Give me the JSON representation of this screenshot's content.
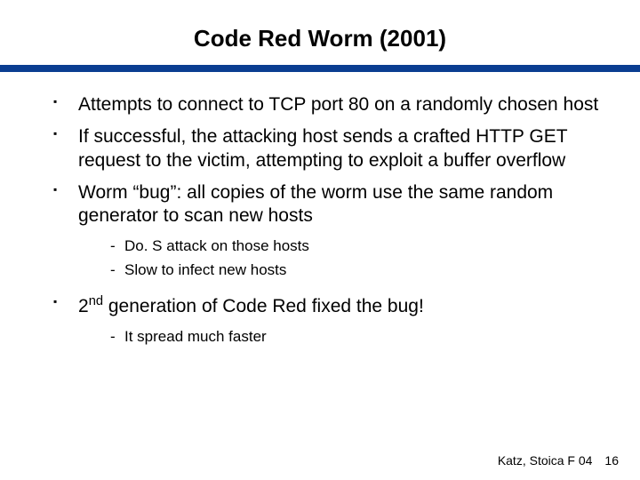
{
  "title": "Code Red Worm (2001)",
  "bullets": [
    {
      "text": "Attempts to connect to TCP port 80 on a randomly chosen host"
    },
    {
      "text": "If successful, the attacking host sends a crafted HTTP GET request to the victim, attempting to exploit a buffer overflow"
    },
    {
      "text": "Worm “bug”: all copies of the worm use the same random generator to scan new hosts",
      "sub": [
        "Do. S attack on those hosts",
        "Slow to infect new hosts"
      ]
    },
    {
      "ord_prefix": "2",
      "ord_sup": "nd",
      "ord_suffix": " generation of Code Red fixed the bug!",
      "sub": [
        "It spread much faster"
      ]
    }
  ],
  "footer": {
    "credit": "Katz, Stoica F 04",
    "page": "16"
  }
}
